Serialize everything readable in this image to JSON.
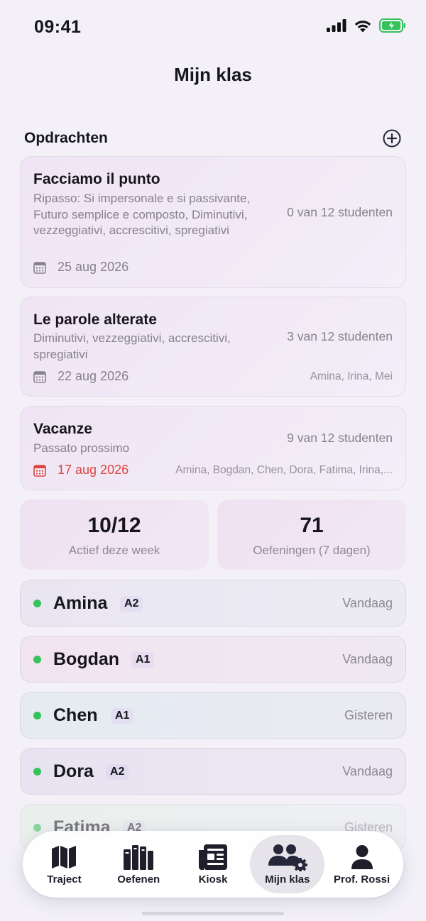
{
  "status": {
    "time": "09:41"
  },
  "header": {
    "title": "Mijn klas"
  },
  "assignments_section": {
    "title": "Opdrachten",
    "add_icon": "plus-circle-icon"
  },
  "assignments": [
    {
      "title": "Facciamo il punto",
      "description": "Ripasso: Si impersonale e si passivante, Futuro semplice e composto, Diminutivi, vezzeggiativi, accrescitivi, spregiativi",
      "progress": "0 van 12 studenten",
      "date": "25 aug 2026",
      "overdue": false,
      "students": ""
    },
    {
      "title": "Le parole alterate",
      "description": "Diminutivi, vezzeggiativi, accrescitivi, spregiativi",
      "progress": "3 van 12 studenten",
      "date": "22 aug 2026",
      "overdue": false,
      "students": "Amina, Irina, Mei"
    },
    {
      "title": "Vacanze",
      "description": "Passato prossimo",
      "progress": "9 van 12 studenten",
      "date": "17 aug 2026",
      "overdue": true,
      "students": "Amina, Bogdan, Chen, Dora, Fatima, Irina,..."
    }
  ],
  "stats": [
    {
      "value": "10/12",
      "label": "Actief deze week"
    },
    {
      "value": "71",
      "label": "Oefeningen (7 dagen)"
    }
  ],
  "students": [
    {
      "name": "Amina",
      "level": "A2",
      "last_active": "Vandaag",
      "status_color": "#34c25a"
    },
    {
      "name": "Bogdan",
      "level": "A1",
      "last_active": "Vandaag",
      "status_color": "#34c25a"
    },
    {
      "name": "Chen",
      "level": "A1",
      "last_active": "Gisteren",
      "status_color": "#34c25a"
    },
    {
      "name": "Dora",
      "level": "A2",
      "last_active": "Vandaag",
      "status_color": "#34c25a"
    },
    {
      "name": "Fatima",
      "level": "A2",
      "last_active": "Gisteren",
      "status_color": "#34c25a"
    }
  ],
  "tabs": [
    {
      "label": "Traject",
      "icon": "map-icon",
      "active": false
    },
    {
      "label": "Oefenen",
      "icon": "books-icon",
      "active": false
    },
    {
      "label": "Kiosk",
      "icon": "newspaper-icon",
      "active": false
    },
    {
      "label": "Mijn klas",
      "icon": "class-settings-icon",
      "active": true
    },
    {
      "label": "Prof. Rossi",
      "icon": "person-icon",
      "active": false
    }
  ],
  "colors": {
    "accent_danger": "#e0433e",
    "online_dot": "#34c25a",
    "battery": "#34c25a"
  }
}
